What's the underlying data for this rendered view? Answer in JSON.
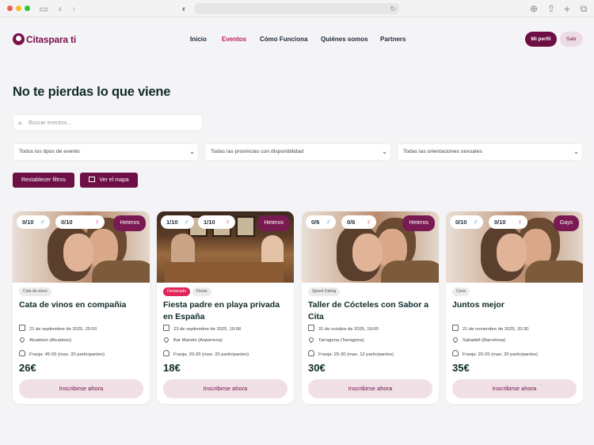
{
  "site": {
    "logo_text": "Citaspara ti",
    "nav": [
      "Inicio",
      "Eventos",
      "Cómo Funciona",
      "Quiénes somos",
      "Partners"
    ],
    "active_nav": "Eventos",
    "profile_label": "Mi perfil",
    "logout_label": "Salir"
  },
  "page": {
    "heading": "No te pierdas lo que viene",
    "search_placeholder": "Buscar eventos...",
    "filters": {
      "type": "Todos los tipos de evento",
      "province": "Todas las provincias con disponibilidad",
      "orientation": "Todas las orientaciones sexuales"
    },
    "reset_label": "Restablecer filtros",
    "map_label": "Ver el mapa"
  },
  "colors": {
    "brand": "#6d0f45",
    "accent": "#c2185b",
    "male": "#2a8bc4",
    "female": "#d6336c"
  },
  "events": [
    {
      "men": "0/10",
      "women": "0/10",
      "orientation": "Heteros",
      "tags": [
        "Cata de vinos"
      ],
      "featured": false,
      "title": "Cata de vinos en compañia",
      "date": "21 de septiembre de 2025, 20:53",
      "location": "Alcadozo (Alcadozo)",
      "range": "Franja: 45-55 (max. 20 participantes)",
      "price": "26€",
      "cta": "Inscribirse ahora"
    },
    {
      "men": "1/10",
      "women": "1/10",
      "orientation": "Heteros",
      "tags": [
        "Destacado",
        "Fiesta"
      ],
      "featured": true,
      "title": "Fiesta padre en playa privada en España",
      "date": "23 de septiembre de 2025, 19:58",
      "location": "Bar Manolo (Asparrena)",
      "range": "Franja: 20-25 (max. 20 participantes)",
      "price": "18€",
      "cta": "Inscribirse ahora"
    },
    {
      "men": "0/6",
      "women": "0/6",
      "orientation": "Heteros",
      "tags": [
        "Speed Dating"
      ],
      "featured": false,
      "title": "Taller de Cócteles con Sabor a Cita",
      "date": "31 de octubre de 2025, 19:00",
      "location": "Tarragona (Tarragona)",
      "range": "Franja: 25-30 (max. 12 participantes)",
      "price": "30€",
      "cta": "Inscribirse ahora"
    },
    {
      "men": "0/10",
      "women": "0/10",
      "orientation": "Gays",
      "tags": [
        "Cena"
      ],
      "featured": false,
      "title": "Juntos mejor",
      "date": "21 de noviembre de 2025, 20:30",
      "location": "Sabadell (Barcelona)",
      "range": "Franja: 20-25 (max. 20 participantes)",
      "price": "35€",
      "cta": "Inscribirse ahora"
    }
  ]
}
